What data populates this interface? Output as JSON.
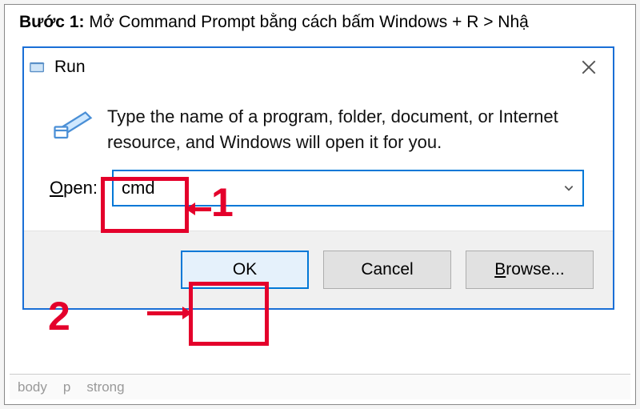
{
  "instruction": {
    "step_label": "Bước 1:",
    "text": " Mở Command Prompt bằng cách bấm Windows + R > Nhậ"
  },
  "dialog": {
    "title": "Run",
    "description": "Type the name of a program, folder, document, or Internet resource, and Windows will open it for you.",
    "open_label_prefix": "O",
    "open_label_rest": "pen:",
    "input_value": "cmd",
    "buttons": {
      "ok": "OK",
      "cancel": "Cancel",
      "browse_accel": "B",
      "browse_rest": "rowse..."
    }
  },
  "callouts": {
    "one": "1",
    "two": "2"
  },
  "footer": {
    "a": "body",
    "b": "p",
    "c": "strong"
  }
}
